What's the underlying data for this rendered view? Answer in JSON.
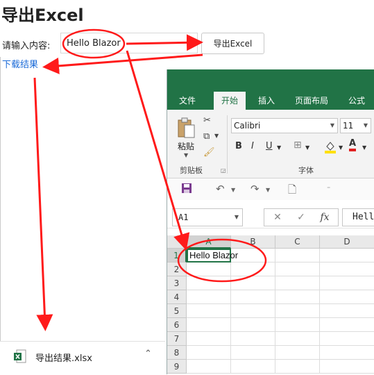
{
  "page": {
    "title": "导出Excel",
    "input_label": "请输入内容:",
    "input_value": "Hello Blazor",
    "export_button": "导出Excel",
    "download_link": "下载结果"
  },
  "excel": {
    "tabs": [
      {
        "label": "文件",
        "active": false
      },
      {
        "label": "开始",
        "active": true
      },
      {
        "label": "插入",
        "active": false
      },
      {
        "label": "页面布局",
        "active": false
      },
      {
        "label": "公式",
        "active": false
      }
    ],
    "ribbon": {
      "paste_label": "粘贴",
      "clipboard_group": "剪贴板",
      "font_name": "Calibri",
      "font_size": "11",
      "font_group": "字体",
      "bold": "B",
      "italic": "I",
      "underline": "U",
      "font_color_letter": "A"
    },
    "formula_bar": {
      "name_box": "A1",
      "fx": "fx",
      "cancel": "✕",
      "enter": "✓",
      "formula_value": "Hello Blazor"
    },
    "columns": [
      "A",
      "B",
      "C",
      "D"
    ],
    "rows": [
      "1",
      "2",
      "3",
      "4",
      "5",
      "6",
      "7",
      "8",
      "9"
    ],
    "cells": {
      "A1": "Hello Blazor"
    },
    "accent_color": "#217346"
  },
  "download_bar": {
    "file_name": "导出结果.xlsx"
  },
  "annotation_color": "#ff1a1a"
}
